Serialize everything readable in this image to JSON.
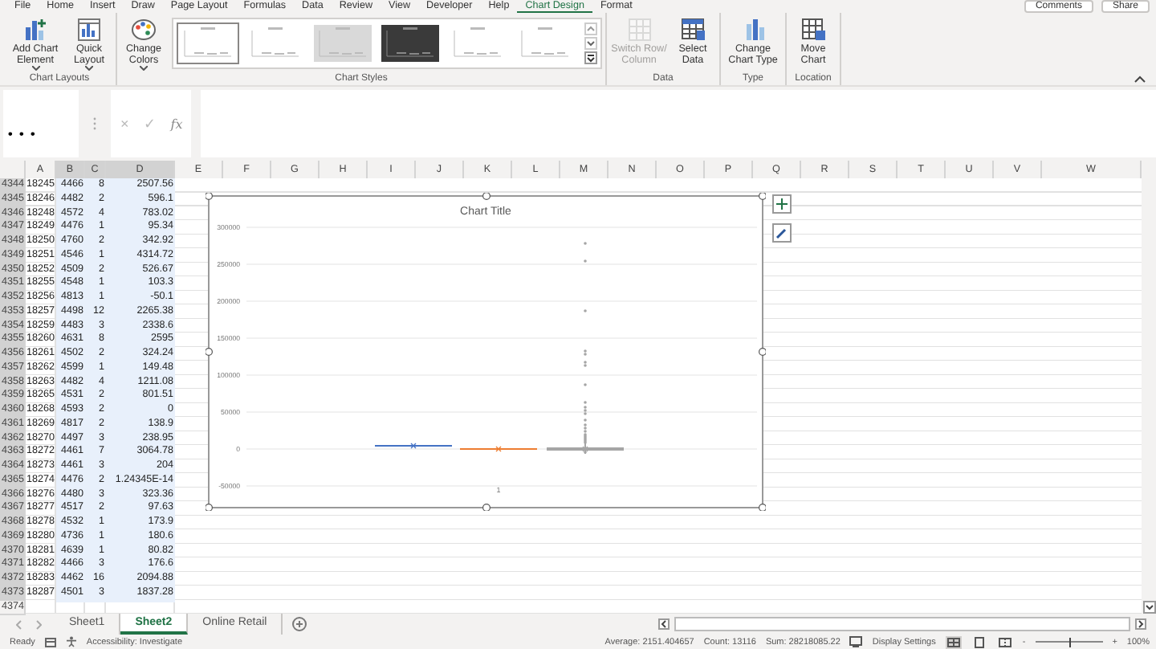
{
  "ribbon_tabs": [
    {
      "label": "File",
      "selected": false
    },
    {
      "label": "Home",
      "selected": false
    },
    {
      "label": "Insert",
      "selected": false
    },
    {
      "label": "Draw",
      "selected": false
    },
    {
      "label": "Page Layout",
      "selected": false
    },
    {
      "label": "Formulas",
      "selected": false
    },
    {
      "label": "Data",
      "selected": false
    },
    {
      "label": "Review",
      "selected": false
    },
    {
      "label": "View",
      "selected": false
    },
    {
      "label": "Developer",
      "selected": false
    },
    {
      "label": "Help",
      "selected": false
    },
    {
      "label": "Chart Design",
      "selected": true
    },
    {
      "label": "Format",
      "selected": false
    }
  ],
  "header_buttons": [
    "Comments",
    "Share"
  ],
  "ribbon_groups": [
    {
      "label": "Chart Layouts",
      "items": [
        {
          "kind": "button",
          "label": "Add Chart Element",
          "dropdown": true,
          "disabled": false
        },
        {
          "kind": "button",
          "label": "Quick Layout",
          "dropdown": true,
          "disabled": false
        }
      ]
    },
    {
      "label": "Chart Styles",
      "items": [
        {
          "kind": "button",
          "label": "Change Colors",
          "dropdown": true,
          "disabled": false
        },
        {
          "kind": "gallery",
          "styles": [
            {
              "kind": "light",
              "selected": true
            },
            {
              "kind": "light",
              "selected": false
            },
            {
              "kind": "grey",
              "selected": false
            },
            {
              "kind": "dark",
              "selected": false
            },
            {
              "kind": "light",
              "selected": false
            },
            {
              "kind": "light",
              "selected": false
            }
          ]
        }
      ]
    },
    {
      "label": "Data",
      "items": [
        {
          "kind": "button",
          "label": "Switch Row/ Column",
          "dropdown": false,
          "disabled": true
        },
        {
          "kind": "button",
          "label": "Select Data",
          "dropdown": false,
          "disabled": false
        }
      ]
    },
    {
      "label": "Type",
      "items": [
        {
          "kind": "button",
          "label": "Change Chart Type",
          "dropdown": false,
          "disabled": false
        }
      ]
    },
    {
      "label": "Location",
      "items": [
        {
          "kind": "button",
          "label": "Move Chart",
          "dropdown": false,
          "disabled": false
        }
      ]
    }
  ],
  "formula_bar": {
    "name_box": "• • •",
    "cancel": "×",
    "enter": "✓",
    "function": "fx"
  },
  "sheet": {
    "columns": [
      {
        "label": "A",
        "selected": false
      },
      {
        "label": "B",
        "selected": true
      },
      {
        "label": "C",
        "selected": true
      },
      {
        "label": "D",
        "selected": true
      },
      {
        "label": "E",
        "selected": false
      },
      {
        "label": "F",
        "selected": false
      },
      {
        "label": "G",
        "selected": false
      },
      {
        "label": "H",
        "selected": false
      },
      {
        "label": "I",
        "selected": false
      },
      {
        "label": "J",
        "selected": false
      },
      {
        "label": "K",
        "selected": false
      },
      {
        "label": "L",
        "selected": false
      },
      {
        "label": "M",
        "selected": false
      },
      {
        "label": "N",
        "selected": false
      },
      {
        "label": "O",
        "selected": false
      },
      {
        "label": "P",
        "selected": false
      },
      {
        "label": "Q",
        "selected": false
      },
      {
        "label": "R",
        "selected": false
      },
      {
        "label": "S",
        "selected": false
      },
      {
        "label": "T",
        "selected": false
      },
      {
        "label": "U",
        "selected": false
      },
      {
        "label": "V",
        "selected": false
      },
      {
        "label": "W",
        "selected": false
      }
    ],
    "rows": [
      {
        "header": "4344",
        "selected": true,
        "cells": [
          "18245",
          "4466",
          "8",
          "2507.56"
        ]
      },
      {
        "header": "4345",
        "selected": true,
        "cells": [
          "18246",
          "4482",
          "2",
          "596.1"
        ]
      },
      {
        "header": "4346",
        "selected": true,
        "cells": [
          "18248",
          "4572",
          "4",
          "783.02"
        ]
      },
      {
        "header": "4347",
        "selected": true,
        "cells": [
          "18249",
          "4476",
          "1",
          "95.34"
        ]
      },
      {
        "header": "4348",
        "selected": true,
        "cells": [
          "18250",
          "4760",
          "2",
          "342.92"
        ]
      },
      {
        "header": "4349",
        "selected": true,
        "cells": [
          "18251",
          "4546",
          "1",
          "4314.72"
        ]
      },
      {
        "header": "4350",
        "selected": true,
        "cells": [
          "18252",
          "4509",
          "2",
          "526.67"
        ]
      },
      {
        "header": "4351",
        "selected": true,
        "cells": [
          "18255",
          "4548",
          "1",
          "103.3"
        ]
      },
      {
        "header": "4352",
        "selected": true,
        "cells": [
          "18256",
          "4813",
          "1",
          "-50.1"
        ]
      },
      {
        "header": "4353",
        "selected": true,
        "cells": [
          "18257",
          "4498",
          "12",
          "2265.38"
        ]
      },
      {
        "header": "4354",
        "selected": true,
        "cells": [
          "18259",
          "4483",
          "3",
          "2338.6"
        ]
      },
      {
        "header": "4355",
        "selected": true,
        "cells": [
          "18260",
          "4631",
          "8",
          "2595"
        ]
      },
      {
        "header": "4356",
        "selected": true,
        "cells": [
          "18261",
          "4502",
          "2",
          "324.24"
        ]
      },
      {
        "header": "4357",
        "selected": true,
        "cells": [
          "18262",
          "4599",
          "1",
          "149.48"
        ]
      },
      {
        "header": "4358",
        "selected": true,
        "cells": [
          "18263",
          "4482",
          "4",
          "1211.08"
        ]
      },
      {
        "header": "4359",
        "selected": true,
        "cells": [
          "18265",
          "4531",
          "2",
          "801.51"
        ]
      },
      {
        "header": "4360",
        "selected": true,
        "cells": [
          "18268",
          "4593",
          "2",
          "0"
        ]
      },
      {
        "header": "4361",
        "selected": true,
        "cells": [
          "18269",
          "4817",
          "2",
          "138.9"
        ]
      },
      {
        "header": "4362",
        "selected": true,
        "cells": [
          "18270",
          "4497",
          "3",
          "238.95"
        ]
      },
      {
        "header": "4363",
        "selected": true,
        "cells": [
          "18272",
          "4461",
          "7",
          "3064.78"
        ]
      },
      {
        "header": "4364",
        "selected": true,
        "cells": [
          "18273",
          "4461",
          "3",
          "204"
        ]
      },
      {
        "header": "4365",
        "selected": true,
        "cells": [
          "18274",
          "4476",
          "2",
          "1.24345E-14"
        ]
      },
      {
        "header": "4366",
        "selected": true,
        "cells": [
          "18276",
          "4480",
          "3",
          "323.36"
        ]
      },
      {
        "header": "4367",
        "selected": true,
        "cells": [
          "18277",
          "4517",
          "2",
          "97.63"
        ]
      },
      {
        "header": "4368",
        "selected": true,
        "cells": [
          "18278",
          "4532",
          "1",
          "173.9"
        ]
      },
      {
        "header": "4369",
        "selected": true,
        "cells": [
          "18280",
          "4736",
          "1",
          "180.6"
        ]
      },
      {
        "header": "4370",
        "selected": true,
        "cells": [
          "18281",
          "4639",
          "1",
          "80.82"
        ]
      },
      {
        "header": "4371",
        "selected": true,
        "cells": [
          "18282",
          "4466",
          "3",
          "176.6"
        ]
      },
      {
        "header": "4372",
        "selected": true,
        "cells": [
          "18283",
          "4462",
          "16",
          "2094.88"
        ]
      },
      {
        "header": "4373",
        "selected": true,
        "cells": [
          "18287",
          "4501",
          "3",
          "1837.28"
        ]
      },
      {
        "header": "4374",
        "selected": false,
        "cells": []
      }
    ]
  },
  "chart": {
    "title": "Chart Title",
    "y_labels": [
      "300000",
      "250000",
      "200000",
      "150000",
      "100000",
      "50000",
      "0",
      "-50000"
    ],
    "x_label": "1",
    "boxes": [
      {
        "color": "#4472c4"
      },
      {
        "color": "#ed7d31"
      },
      {
        "color": "#a5a5a5"
      }
    ]
  },
  "sheet_tabs": [
    {
      "label": "Sheet1",
      "selected": false
    },
    {
      "label": "Sheet2",
      "selected": true
    },
    {
      "label": "Online Retail",
      "selected": false
    }
  ],
  "status_bar": {
    "mode": "Ready",
    "accessibility": "Accessibility: Investigate",
    "stats": [
      "Average: 2151.404657",
      "Count: 13116",
      "Sum: 28218085.22"
    ],
    "display_settings": "Display Settings",
    "views": [
      {
        "selected": true
      },
      {
        "selected": false
      },
      {
        "selected": false
      }
    ],
    "zoom_out": "-",
    "zoom_in": "+",
    "zoom": {
      "level": 0.5
    },
    "zoom_label": "100%"
  }
}
